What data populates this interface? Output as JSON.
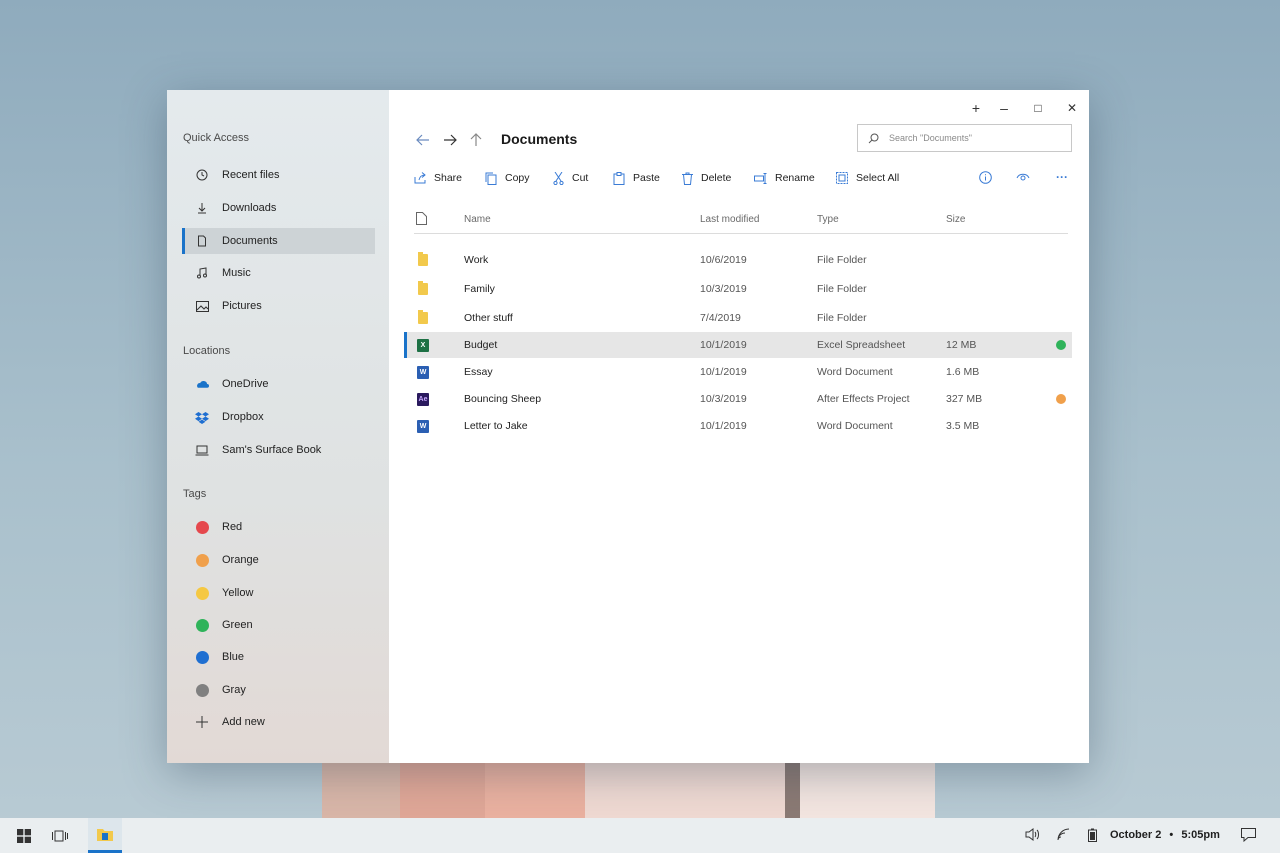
{
  "sidebar": {
    "quick_access_title": "Quick Access",
    "quick_access": [
      {
        "label": "Recent files",
        "icon": "clock-icon"
      },
      {
        "label": "Downloads",
        "icon": "download-icon"
      },
      {
        "label": "Documents",
        "icon": "document-icon",
        "active": true
      },
      {
        "label": "Music",
        "icon": "music-icon"
      },
      {
        "label": "Pictures",
        "icon": "picture-icon"
      }
    ],
    "locations_title": "Locations",
    "locations": [
      {
        "label": "OneDrive",
        "icon": "onedrive-icon"
      },
      {
        "label": "Dropbox",
        "icon": "dropbox-icon"
      },
      {
        "label": "Sam's Surface Book",
        "icon": "laptop-icon"
      }
    ],
    "tags_title": "Tags",
    "tags": [
      {
        "label": "Red",
        "color": "#e5484d"
      },
      {
        "label": "Orange",
        "color": "#f0a04b"
      },
      {
        "label": "Yellow",
        "color": "#f5c842"
      },
      {
        "label": "Green",
        "color": "#2fb35a"
      },
      {
        "label": "Blue",
        "color": "#1f6fd1"
      },
      {
        "label": "Gray",
        "color": "#808080"
      }
    ],
    "add_new_label": "Add new"
  },
  "window_controls": {
    "new": "+",
    "minimize": "–",
    "maximize": "□",
    "close": "✕"
  },
  "breadcrumb": "Documents",
  "search": {
    "placeholder": "Search \"Documents\""
  },
  "toolbar": {
    "share": "Share",
    "copy": "Copy",
    "cut": "Cut",
    "paste": "Paste",
    "delete": "Delete",
    "rename": "Rename",
    "select_all": "Select All",
    "more": "···"
  },
  "columns": {
    "name": "Name",
    "modified": "Last modified",
    "type": "Type",
    "size": "Size"
  },
  "files": [
    {
      "name": "Work",
      "modified": "10/6/2019",
      "type": "File Folder",
      "size": "",
      "kind": "folder"
    },
    {
      "name": "Family",
      "modified": "10/3/2019",
      "type": "File Folder",
      "size": "",
      "kind": "folder"
    },
    {
      "name": "Other stuff",
      "modified": "7/4/2019",
      "type": "File Folder",
      "size": "",
      "kind": "folder"
    },
    {
      "name": "Budget",
      "modified": "10/1/2019",
      "type": "Excel Spreadsheet",
      "size": "12 MB",
      "kind": "excel",
      "tag_color": "#2fb35a",
      "selected": true
    },
    {
      "name": "Essay",
      "modified": "10/1/2019",
      "type": "Word Document",
      "size": "1.6 MB",
      "kind": "word"
    },
    {
      "name": "Bouncing Sheep",
      "modified": "10/3/2019",
      "type": "After Effects Project",
      "size": "327 MB",
      "kind": "ae",
      "tag_color": "#f0a04b"
    },
    {
      "name": "Letter to Jake",
      "modified": "10/1/2019",
      "type": "Word Document",
      "size": "3.5 MB",
      "kind": "word"
    }
  ],
  "taskbar": {
    "date": "October 2",
    "separator": "•",
    "time": "5:05pm"
  }
}
